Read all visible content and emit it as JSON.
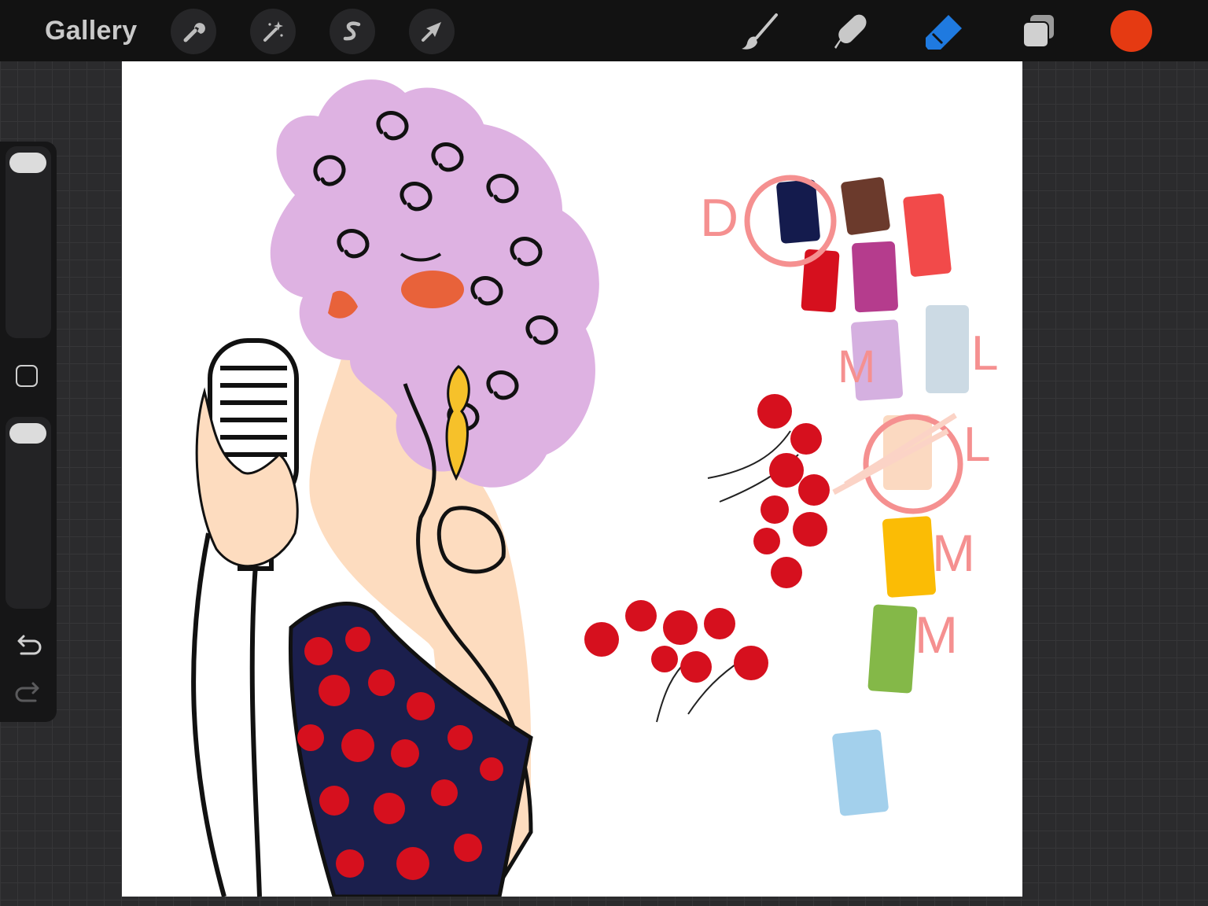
{
  "topbar": {
    "gallery_label": "Gallery",
    "left_tools": [
      "actions-wrench",
      "adjustments-wand",
      "selection",
      "transform-arrow"
    ],
    "right_tools": [
      "brush",
      "smudge",
      "eraser",
      "layers"
    ],
    "active_tool": "eraser",
    "current_color": "#e53a12"
  },
  "colors": {
    "accent_blue": "#1f7ae0",
    "toolbar_bg": "#121212",
    "canvas_bg": "#ffffff"
  },
  "sidebar": {
    "controls": [
      "brush-size-slider",
      "modify-button",
      "opacity-slider",
      "undo",
      "redo"
    ]
  },
  "canvas": {
    "annotations": {
      "dark_letter": "D",
      "medium_letter_1": "M",
      "light_letter_1": "L",
      "light_letter_2": "L",
      "medium_letter_2": "M",
      "medium_letter_3": "M"
    },
    "palette_swatches": [
      {
        "name": "navy",
        "color": "#141b4d"
      },
      {
        "name": "brown",
        "color": "#6b3a2c"
      },
      {
        "name": "coral-red",
        "color": "#f24a4a"
      },
      {
        "name": "red",
        "color": "#d6101e"
      },
      {
        "name": "magenta",
        "color": "#b53c8d"
      },
      {
        "name": "lilac",
        "color": "#d5b0e0"
      },
      {
        "name": "pale-blue-grey",
        "color": "#ccdae4"
      },
      {
        "name": "peach",
        "color": "#fbd9c1"
      },
      {
        "name": "yellow",
        "color": "#fbbc05"
      },
      {
        "name": "green",
        "color": "#84b848"
      },
      {
        "name": "sky-blue",
        "color": "#a3d0ec"
      }
    ]
  }
}
